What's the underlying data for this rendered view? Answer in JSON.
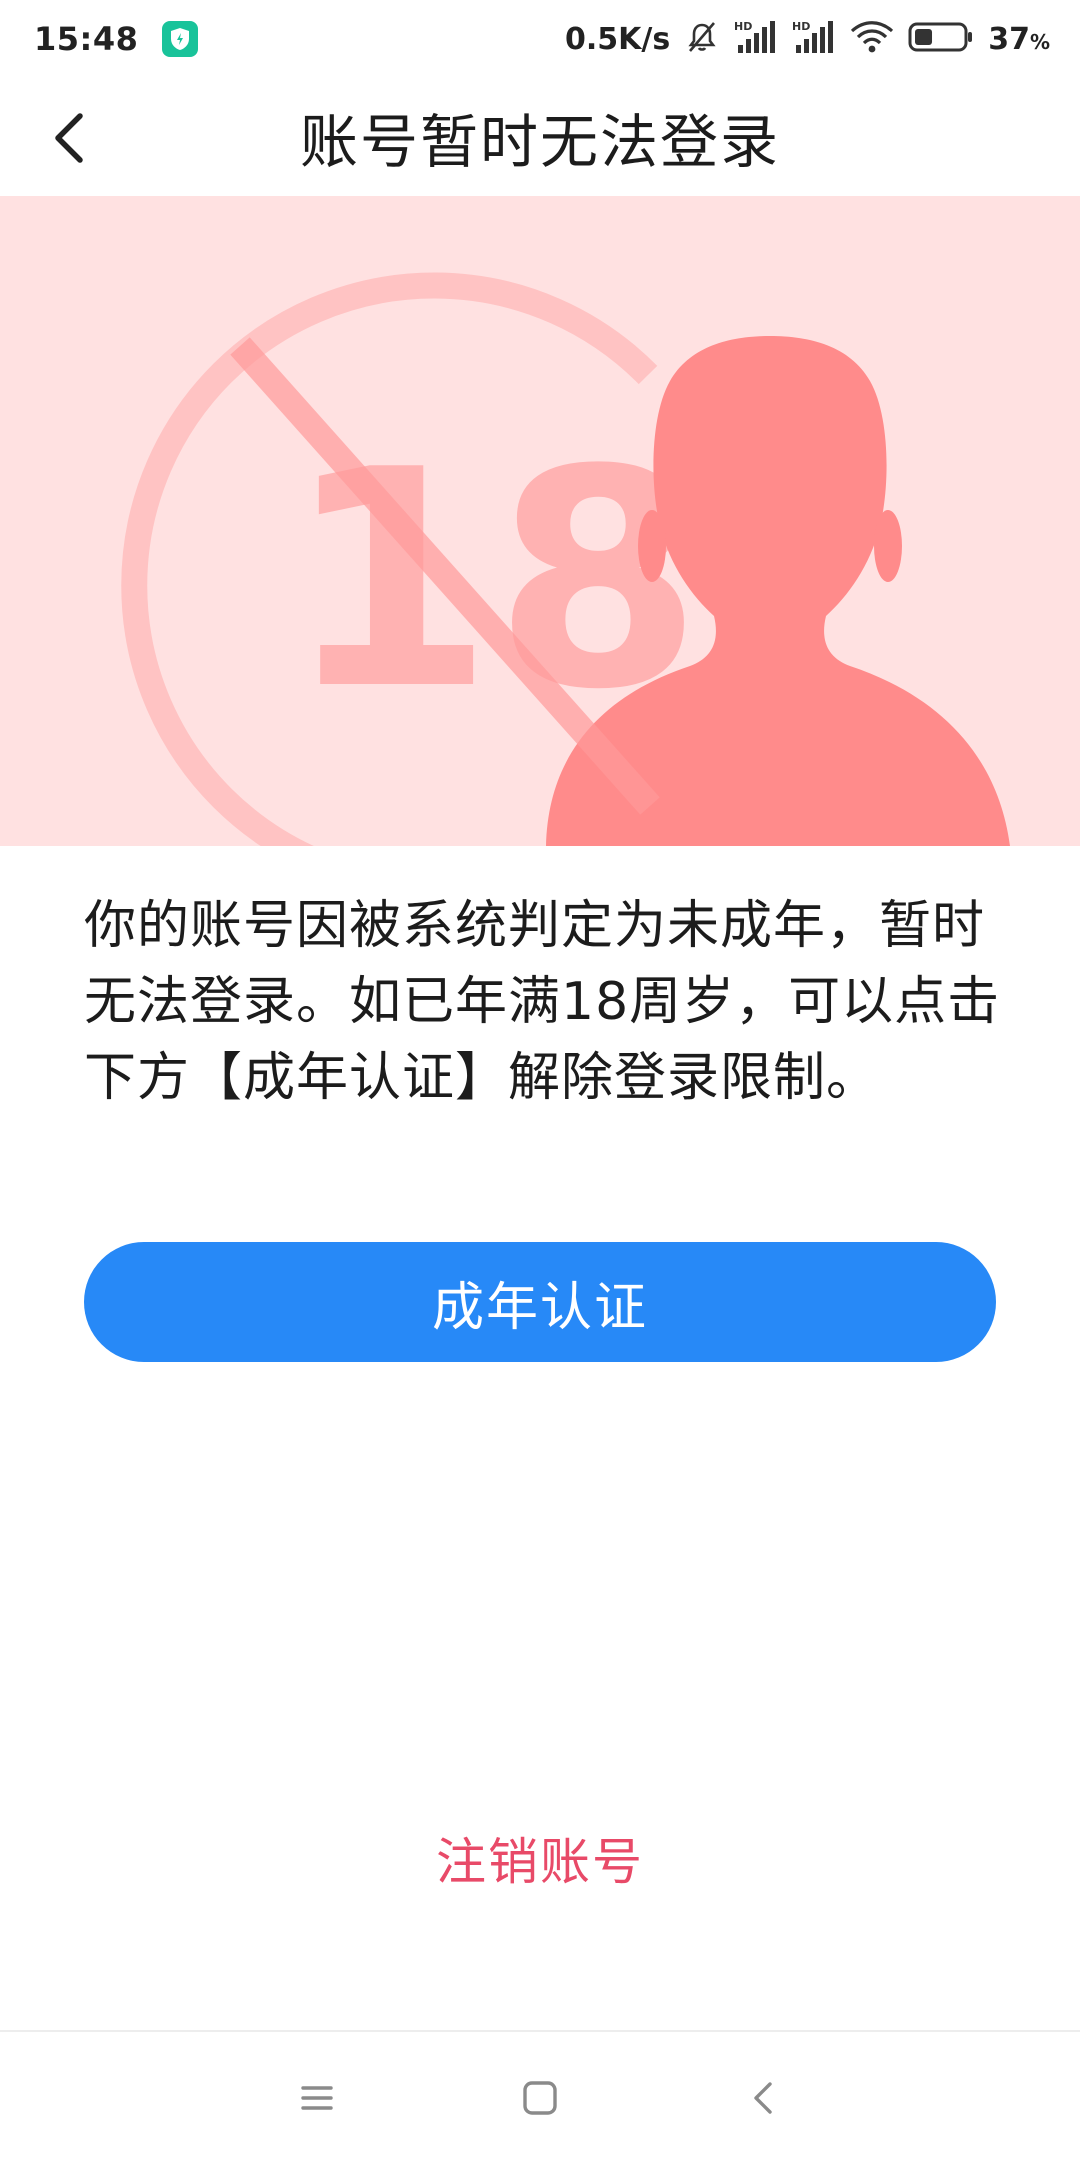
{
  "status_bar": {
    "time": "15:48",
    "app_icon": "shield-app-icon",
    "network_speed": "0.5K/s",
    "icons": [
      "mute-icon",
      "signal-hd-icon",
      "signal-hd-icon",
      "wifi-icon",
      "battery-icon"
    ],
    "battery_percent": "37",
    "battery_percent_unit": "%",
    "battery_level": 0.37
  },
  "header": {
    "back_icon": "back-arrow-icon",
    "title": "账号暂时无法登录"
  },
  "hero": {
    "illustration": "under-18-prohibited-illustration",
    "badge_number": "18"
  },
  "message": {
    "text": "你的账号因被系统判定为未成年，暂时无法登录。如已年满18周岁，可以点击下方【成年认证】解除登录限制。"
  },
  "actions": {
    "verify_label": "成年认证",
    "deregister_label": "注销账号"
  },
  "nav_bar": {
    "items": [
      "menu-icon",
      "home-icon",
      "back-icon"
    ]
  },
  "colors": {
    "accent": "#2789f7",
    "danger": "#e84a68",
    "hero_bg": "#ffe1e1",
    "silhouette": "#ff8b8b"
  }
}
